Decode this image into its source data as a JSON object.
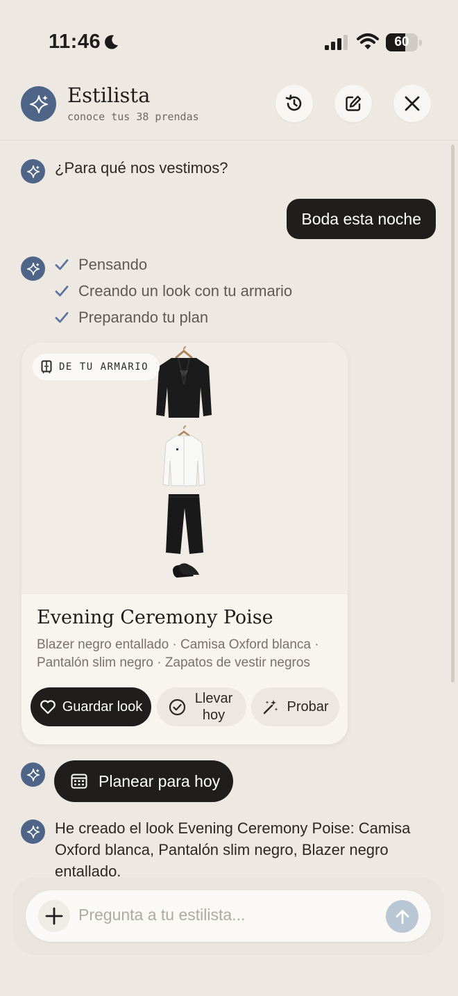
{
  "status_bar": {
    "time": "11:46",
    "battery": "60",
    "battery_level": 0.6
  },
  "header": {
    "title": "Estilista",
    "subtitle": "conoce tus 38 prendas",
    "icons": [
      "sparkles-icon",
      "history-icon",
      "edit-icon",
      "close-icon"
    ]
  },
  "chat": {
    "question": "¿Para qué nos vestimos?",
    "user_message": "Boda esta noche",
    "steps": [
      {
        "label": "Pensando"
      },
      {
        "label": "Creando un look con tu armario"
      },
      {
        "label": "Preparando tu plan"
      }
    ],
    "outfit_card": {
      "badge": "DE TU ARMARIO",
      "title": "Evening Ceremony Poise",
      "items": "Blazer negro entallado · Camisa Oxford blanca · Pantalón slim negro · Zapatos de vestir negros",
      "actions": {
        "save": "Guardar look",
        "wear_today": "Llevar hoy",
        "try_on": "Probar"
      }
    },
    "plan_button": "Planear para hoy",
    "final_message": "He creado el look Evening Ceremony Poise: Camisa Oxford blanca, Pantalón slim negro, Blazer negro entallado."
  },
  "composer": {
    "placeholder": "Pregunta a tu estilista..."
  },
  "colors": {
    "accent": "#4e6588",
    "dark": "#1f1e1c",
    "background": "#ede9e2",
    "send_disabled": "#b9c6d3"
  }
}
